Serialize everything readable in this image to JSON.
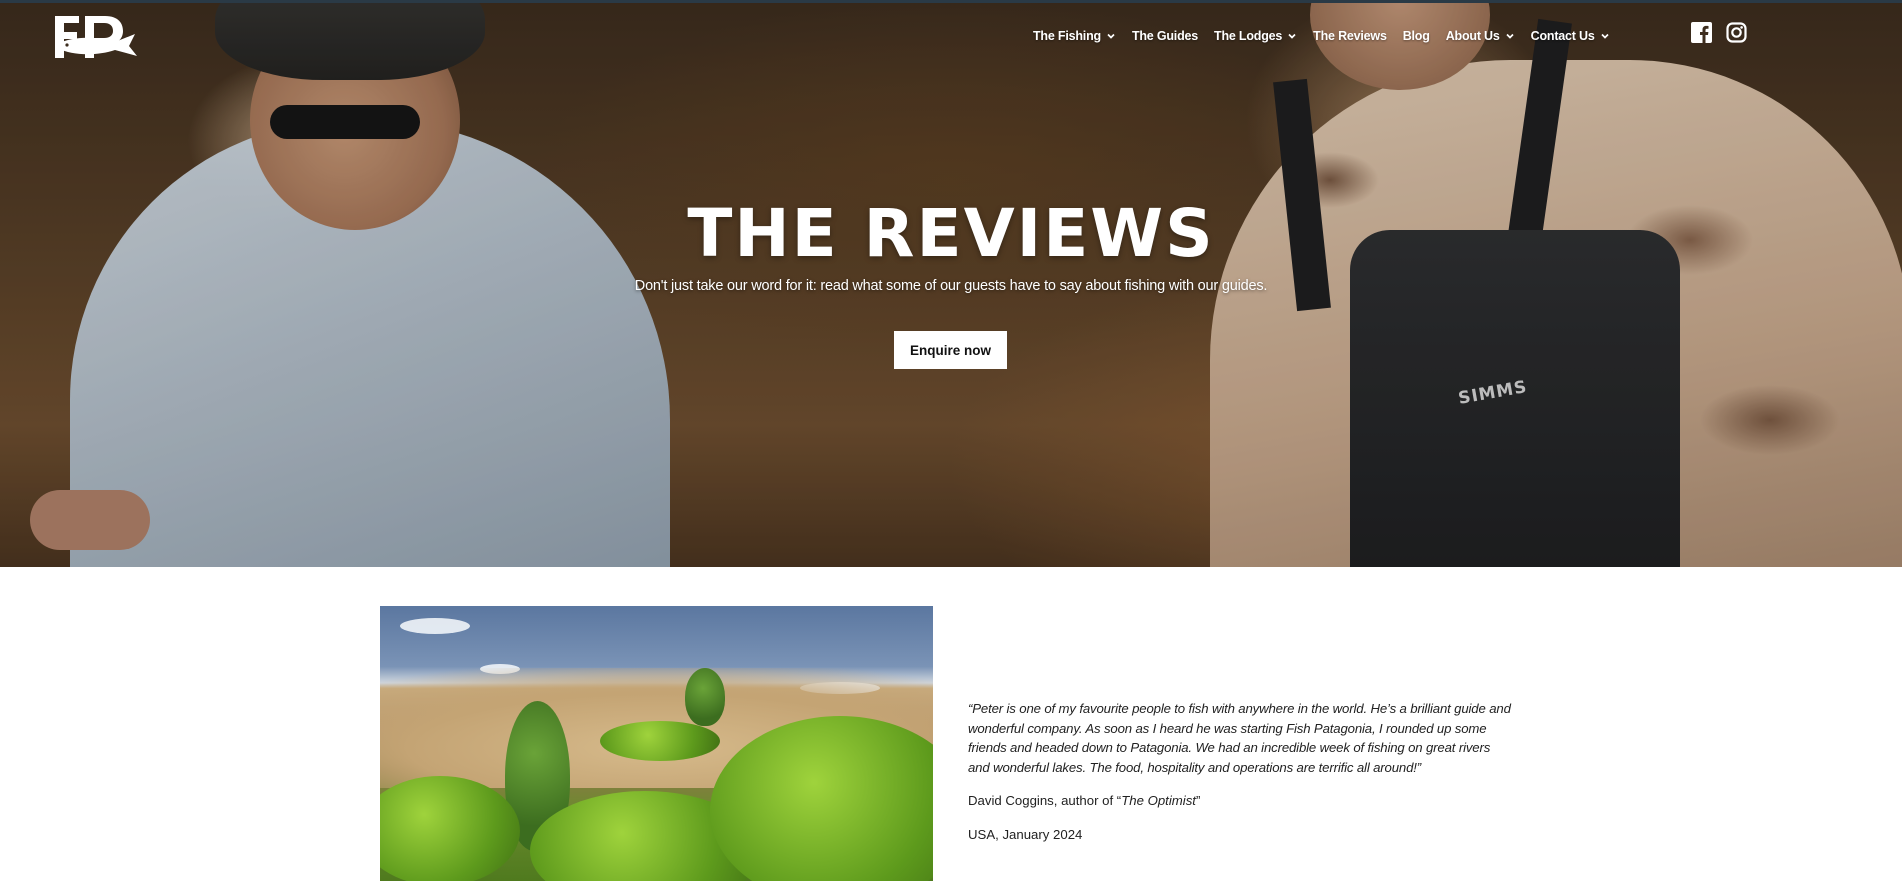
{
  "brand": {
    "logo_text": "FP",
    "logo_icon": "fish-patagonia-logo"
  },
  "nav": {
    "items": [
      {
        "label": "The Fishing",
        "dropdown": true
      },
      {
        "label": "The Guides",
        "dropdown": false
      },
      {
        "label": "The Lodges",
        "dropdown": true
      },
      {
        "label": "The Reviews",
        "dropdown": false
      },
      {
        "label": "Blog",
        "dropdown": false
      },
      {
        "label": "About Us",
        "dropdown": true
      },
      {
        "label": "Contact Us",
        "dropdown": true
      }
    ],
    "social": [
      {
        "icon": "facebook-icon"
      },
      {
        "icon": "instagram-icon"
      }
    ]
  },
  "hero": {
    "title": "THE REVIEWS",
    "subtitle": "Don't just take our word for it: read what some of our guests have to say about fishing with our guides.",
    "cta_label": "Enquire now",
    "waders_logo": "SIMMS"
  },
  "review": {
    "quote": "“Peter is one of my favourite people to fish with anywhere in the world. He’s a brilliant guide and wonderful company. As soon as I heard he was starting Fish Patagonia, I rounded up some friends and headed down to Patagonia. We had an incredible week of fishing on great rivers and wonderful lakes. The food, hospitality and operations are terrific all around!”",
    "author_prefix": "David Coggins, author of “",
    "author_book": "The Optimist",
    "author_suffix": "”",
    "location_date": "USA, January 2024"
  },
  "colors": {
    "text": "#222222",
    "white": "#ffffff",
    "hero_overlay": "#3d2d1e"
  }
}
